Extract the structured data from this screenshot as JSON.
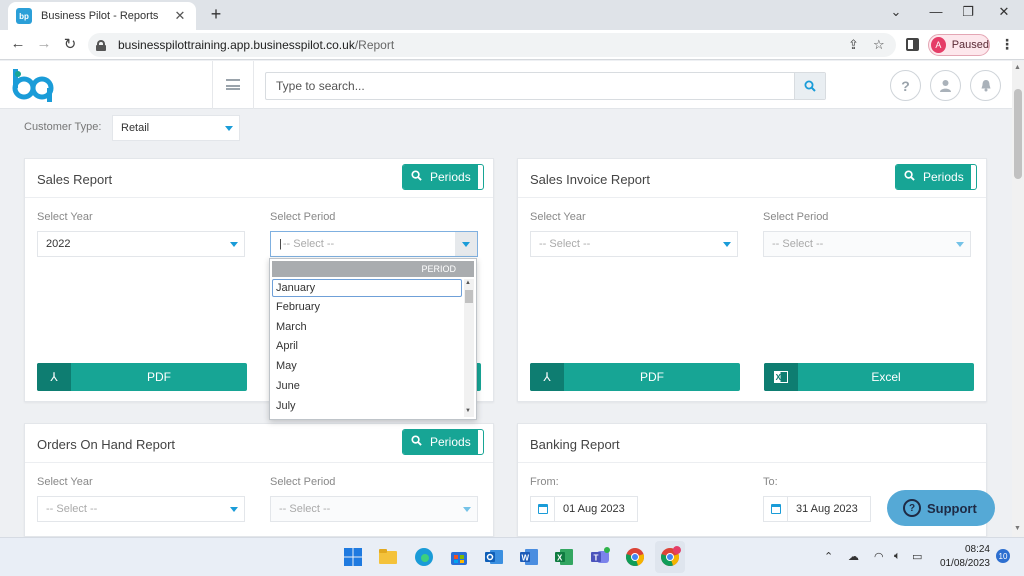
{
  "browser": {
    "tab_title": "Business Pilot - Reports",
    "favicon_text": "bp",
    "url_host": "businesspilottraining.app.businesspilot.co.uk",
    "url_path": "/Report",
    "profile_initial": "A",
    "profile_status": "Paused"
  },
  "header": {
    "search_placeholder": "Type to search...",
    "icons": [
      "help-icon",
      "user-icon",
      "bell-icon"
    ]
  },
  "filters": {
    "customer_type_label": "Customer Type:",
    "customer_type_value": "Retail"
  },
  "cards": {
    "sales": {
      "title": "Sales Report",
      "periods_label": "Periods",
      "year_label": "Select Year",
      "year_value": "2022",
      "period_label": "Select Period",
      "period_value": "-- Select --",
      "pdf_label": "PDF"
    },
    "sales_invoice": {
      "title": "Sales Invoice Report",
      "periods_label": "Periods",
      "year_label": "Select Year",
      "year_value": "-- Select --",
      "period_label": "Select Period",
      "period_value": "-- Select --",
      "pdf_label": "PDF",
      "excel_label": "Excel"
    },
    "orders": {
      "title": "Orders On Hand Report",
      "periods_label": "Periods",
      "year_label": "Select Year",
      "year_value": "-- Select --",
      "period_label": "Select Period",
      "period_value": "-- Select --"
    },
    "banking": {
      "title": "Banking Report",
      "from_label": "From:",
      "from_value": "01 Aug 2023",
      "to_label": "To:",
      "to_value": "31 Aug 2023"
    }
  },
  "period_dropdown": {
    "header": "PERIOD",
    "items": [
      "January",
      "February",
      "March",
      "April",
      "May",
      "June",
      "July"
    ]
  },
  "support_label": "Support",
  "taskbar": {
    "time": "08:24",
    "date": "01/08/2023",
    "notifications": "10"
  },
  "colors": {
    "accent": "#17a595",
    "accent_dark": "#0e7d71",
    "brand_blue": "#1a9cd8"
  }
}
